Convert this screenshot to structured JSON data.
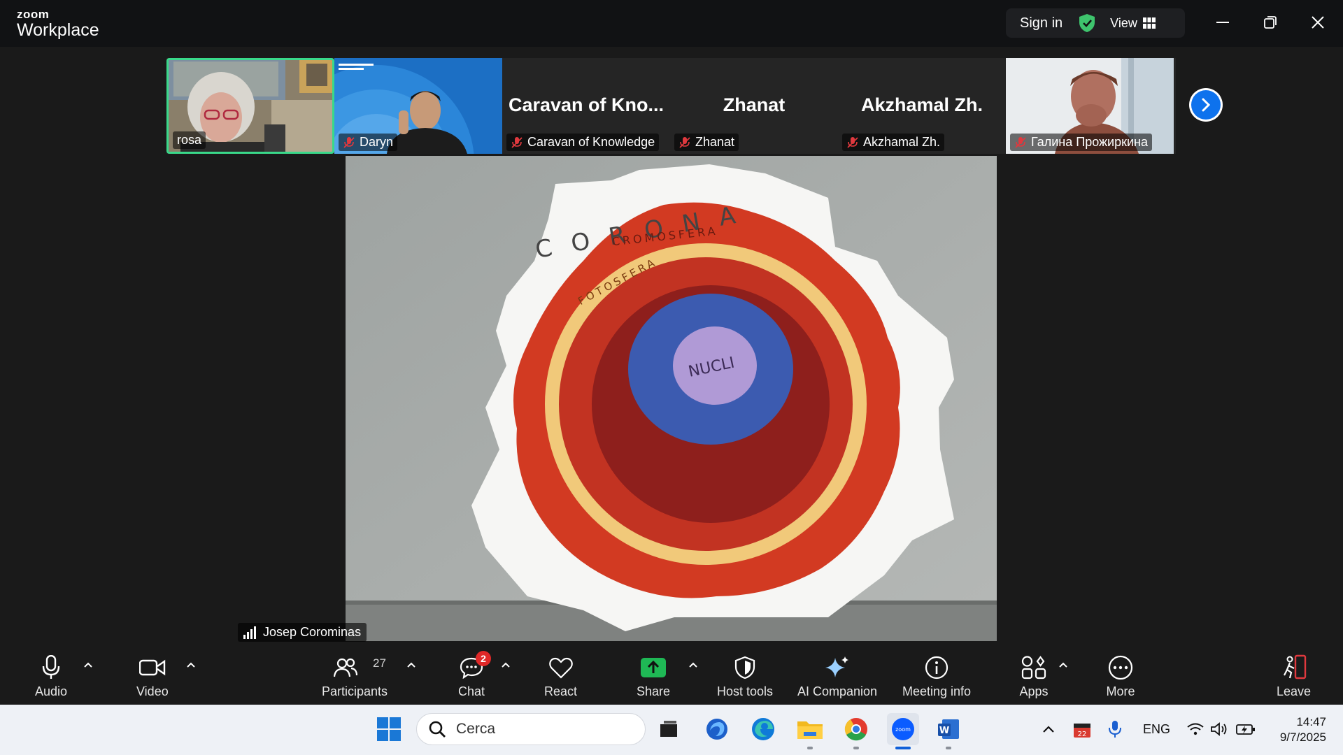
{
  "titlebar": {
    "logo_small": "zoom",
    "logo_big": "Workplace",
    "signin": "Sign in",
    "view": "View",
    "colors": {
      "shield": "#3ec46d"
    }
  },
  "participants_strip": [
    {
      "name": "rosa",
      "muted": false,
      "active": true
    },
    {
      "name": "Daryn",
      "muted": true
    },
    {
      "name": "Caravan of Knowledge",
      "display_center": "Caravan of Kno...",
      "muted": true
    },
    {
      "name": "Zhanat",
      "display_center": "Zhanat",
      "muted": true
    },
    {
      "name": "Akzhamal Zh.",
      "display_center": "Akzhamal Zh.",
      "muted": true
    },
    {
      "name": "Галина Прожиркина",
      "muted": true
    }
  ],
  "main_video": {
    "speaker": "Josep Corominas",
    "paper_texts": {
      "top": "C O R O N A",
      "ring2": "CROMOSFERA",
      "ring3": "FOTOSFERA",
      "core": "NUCLI"
    }
  },
  "toolbar": {
    "audio": "Audio",
    "video": "Video",
    "participants": "Participants",
    "participants_count": "27",
    "chat": "Chat",
    "chat_badge": "2",
    "react": "React",
    "share": "Share",
    "host_tools": "Host tools",
    "ai_companion": "AI Companion",
    "meeting_info": "Meeting info",
    "apps": "Apps",
    "more": "More",
    "leave": "Leave"
  },
  "taskbar": {
    "search_placeholder": "Cerca",
    "lang": "ENG",
    "time": "14:47",
    "date": "9/7/2025",
    "calendar_badge": "22"
  }
}
